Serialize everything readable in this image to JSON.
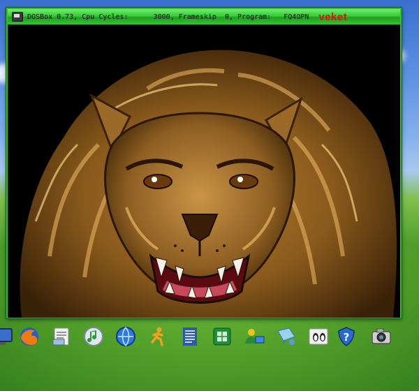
{
  "window": {
    "title": "DOSBox 0.73, Cpu Cycles:      3000, Frameskip  0, Program:   FQ4OPN",
    "brand": "veket"
  },
  "colors": {
    "frame": "#2fbf2f",
    "brand": "#e01010"
  },
  "taskbar": {
    "icons": [
      "monitor-icon",
      "firefox-icon",
      "text-editor-icon",
      "music-player-icon",
      "globe-icon",
      "running-man-icon",
      "document-icon",
      "spreadsheet-icon",
      "network-user-icon",
      "chat-icon",
      "penguin-tools-icon",
      "help-shield-icon",
      "camera-icon"
    ]
  }
}
